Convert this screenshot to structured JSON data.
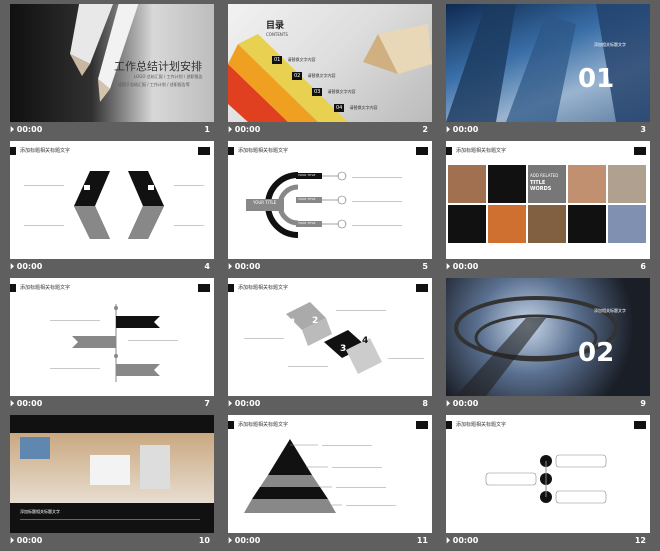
{
  "slides": [
    {
      "num": "1",
      "time": "00:00",
      "title": "工作总结计划安排",
      "subtitle": "LOGO 总结汇报 / 工作计划 / 述职报告",
      "subtitle2": "适用于总结汇报 / 工作计划 / 述职报告等"
    },
    {
      "num": "2",
      "time": "00:00",
      "toc_title": "目录",
      "toc_sub": "CONTENTS",
      "items": [
        {
          "n": "01",
          "t": "请替换文字内容"
        },
        {
          "n": "02",
          "t": "请替换文字内容"
        },
        {
          "n": "03",
          "t": "请替换文字内容"
        },
        {
          "n": "04",
          "t": "请替换文字内容"
        }
      ]
    },
    {
      "num": "3",
      "time": "00:00",
      "section": "01",
      "label": "添加相关标题文字"
    },
    {
      "num": "4",
      "time": "00:00",
      "header": "添加标题相关标题文字"
    },
    {
      "num": "5",
      "time": "00:00",
      "header": "添加标题相关标题文字",
      "center": "YOUR TITLE",
      "labels": [
        "YOUR TITLE",
        "YOUR TITLE",
        "YOUR TITLE"
      ]
    },
    {
      "num": "6",
      "time": "00:00",
      "header": "添加标题相关标题文字",
      "add1": "ADD RELATED",
      "add2": "TITLE WORDS"
    },
    {
      "num": "7",
      "time": "00:00",
      "header": "添加标题相关标题文字"
    },
    {
      "num": "8",
      "time": "00:00",
      "header": "添加标题相关标题文字",
      "steps": [
        "1",
        "2",
        "3",
        "4"
      ]
    },
    {
      "num": "9",
      "time": "00:00",
      "section": "02",
      "label": "添加相关标题文字"
    },
    {
      "num": "10",
      "time": "00:00",
      "header": "添加标题相关标题文字",
      "caption": "添加标题相关标题文字"
    },
    {
      "num": "11",
      "time": "00:00",
      "header": "添加标题相关标题文字"
    },
    {
      "num": "12",
      "time": "00:00",
      "header": "添加标题相关标题文字"
    }
  ]
}
